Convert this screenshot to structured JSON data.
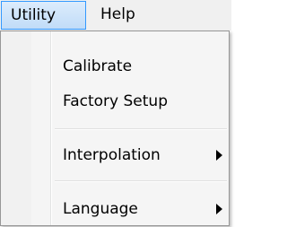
{
  "menubar": {
    "items": [
      {
        "label": "Utility",
        "active": true
      },
      {
        "label": "Help",
        "active": false
      }
    ]
  },
  "dropdown": {
    "items": [
      {
        "label": "Calibrate",
        "submenu": false
      },
      {
        "label": "Factory Setup",
        "submenu": false
      },
      {
        "label": "Interpolation",
        "submenu": true,
        "arrow_icon": "chevron-right-icon"
      },
      {
        "label": "Language",
        "submenu": true,
        "arrow_icon": "chevron-right-icon"
      }
    ]
  },
  "colors": {
    "menubar_bg": "#f0f0f0",
    "active_border": "#3399ff",
    "active_fill": "#c1dcf8",
    "dropdown_bg": "#f5f5f5",
    "dropdown_border": "#979797"
  }
}
